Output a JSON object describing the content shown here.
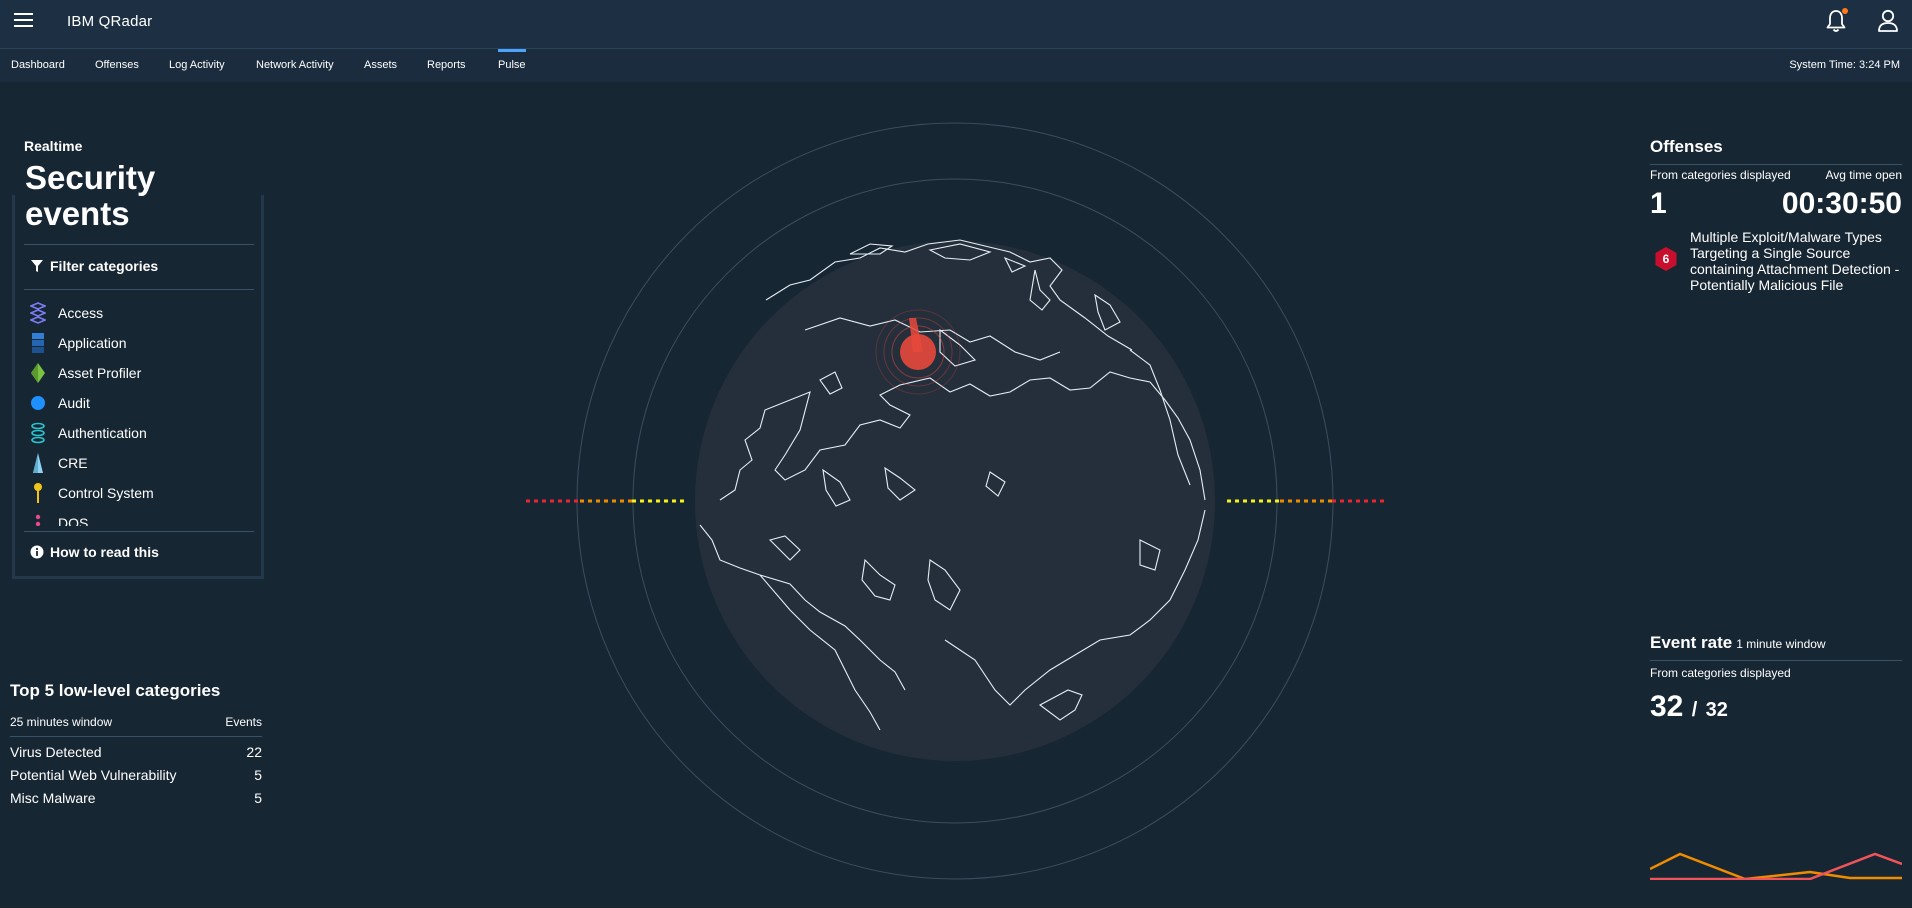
{
  "app": {
    "title": "IBM QRadar"
  },
  "nav": {
    "tabs": [
      {
        "label": "Dashboard"
      },
      {
        "label": "Offenses"
      },
      {
        "label": "Log Activity"
      },
      {
        "label": "Network Activity"
      },
      {
        "label": "Assets"
      },
      {
        "label": "Reports"
      },
      {
        "label": "Pulse"
      }
    ],
    "active_tab": "Pulse",
    "system_time": "System Time: 3:24 PM"
  },
  "header_icons": [
    "menu-icon",
    "notification-bell-icon",
    "user-icon"
  ],
  "security": {
    "label": "Realtime",
    "title": "Security events",
    "filter_label": "Filter categories",
    "categories": [
      {
        "label": "Access",
        "icon": "stacked-diamond-icon",
        "color": "#7b7cf0"
      },
      {
        "label": "Application",
        "icon": "cube-stack-icon",
        "color": "#2f7fd6"
      },
      {
        "label": "Asset Profiler",
        "icon": "gem-icon",
        "color": "#7cc242"
      },
      {
        "label": "Audit",
        "icon": "sphere-icon",
        "color": "#1e90ff"
      },
      {
        "label": "Authentication",
        "icon": "rings-icon",
        "color": "#26c6d0"
      },
      {
        "label": "CRE",
        "icon": "cone-icon",
        "color": "#8fd3f4"
      },
      {
        "label": "Control System",
        "icon": "pin-icon",
        "color": "#f0c419"
      },
      {
        "label": "DOS",
        "icon": "dots-icon",
        "color": "#e84a8a"
      }
    ],
    "how_to_read": "How to read this"
  },
  "top5": {
    "title": "Top 5 low-level categories",
    "window": "25 minutes window",
    "events_header": "Events",
    "rows": [
      {
        "name": "Virus Detected",
        "count": "22"
      },
      {
        "name": "Potential Web Vulnerability",
        "count": "5"
      },
      {
        "name": "Misc Malware",
        "count": "5"
      }
    ]
  },
  "offenses": {
    "title": "Offenses",
    "from_label": "From categories displayed",
    "avg_label": "Avg time open",
    "count": "1",
    "avg_time": "00:30:50",
    "items": [
      {
        "severity": "6",
        "text": "Multiple Exploit/Malware Types Targeting a Single Source containing Attachment Detection - Potentially Malicious File"
      }
    ]
  },
  "event_rate": {
    "title": "Event rate",
    "window": "1 minute window",
    "from_label": "From categories displayed",
    "current": "32",
    "separator": "/",
    "total": "32",
    "series_colors": [
      "#f08c00",
      "#f0545a"
    ]
  },
  "colors": {
    "background": "#172633",
    "topbar": "#1d3043",
    "accent": "#4aa3ff",
    "offense_badge": "#c8102e",
    "hotspot": "#e8493c"
  }
}
